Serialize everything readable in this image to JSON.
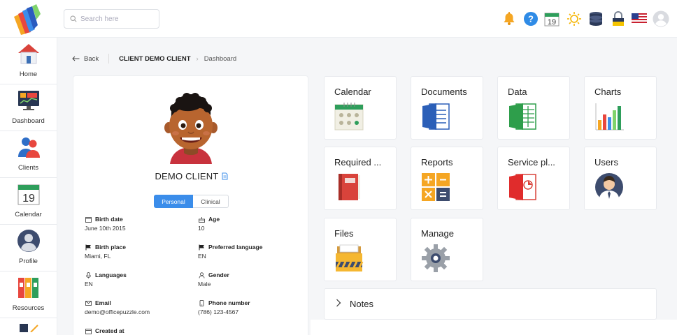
{
  "header": {
    "search_placeholder": "Search here",
    "icons": [
      "bell-icon",
      "help-icon",
      "calendar-icon",
      "sun-icon",
      "database-icon",
      "lock-icon",
      "us-flag-icon",
      "user-avatar-icon"
    ],
    "calendar_day": "19"
  },
  "sidebar": {
    "items": [
      {
        "label": "Home",
        "icon": "house-icon"
      },
      {
        "label": "Dashboard",
        "icon": "dashboard-icon"
      },
      {
        "label": "Clients",
        "icon": "clients-icon"
      },
      {
        "label": "Calendar",
        "icon": "calendar-icon",
        "day": "19"
      },
      {
        "label": "Profile",
        "icon": "profile-icon"
      },
      {
        "label": "Resources",
        "icon": "binders-icon"
      }
    ]
  },
  "breadcrumb": {
    "back": "Back",
    "client": "CLIENT DEMO CLIENT",
    "current": "Dashboard"
  },
  "profile": {
    "name": "DEMO CLIENT",
    "tabs": {
      "personal": "Personal",
      "clinical": "Clinical"
    },
    "fields": {
      "birth_date": {
        "label": "Birth date",
        "value": "June 10th 2015"
      },
      "age": {
        "label": "Age",
        "value": "10"
      },
      "birth_place": {
        "label": "Birth place",
        "value": "Miami, FL"
      },
      "preferred_language": {
        "label": "Preferred language",
        "value": "EN"
      },
      "languages": {
        "label": "Languages",
        "value": "EN"
      },
      "gender": {
        "label": "Gender",
        "value": "Male"
      },
      "email": {
        "label": "Email",
        "value": "demo@officepuzzle.com"
      },
      "phone": {
        "label": "Phone number",
        "value": "(786) 123-4567"
      },
      "created_at": {
        "label": "Created at"
      }
    }
  },
  "tiles": {
    "calendar": "Calendar",
    "documents": "Documents",
    "data": "Data",
    "charts": "Charts",
    "required": "Required ...",
    "reports": "Reports",
    "service_plans": "Service pl...",
    "users": "Users",
    "files": "Files",
    "manage": "Manage"
  },
  "notes": {
    "label": "Notes"
  },
  "colors": {
    "primary": "#3b8dea",
    "border": "#e8eaee",
    "background": "#f5f6f8"
  }
}
